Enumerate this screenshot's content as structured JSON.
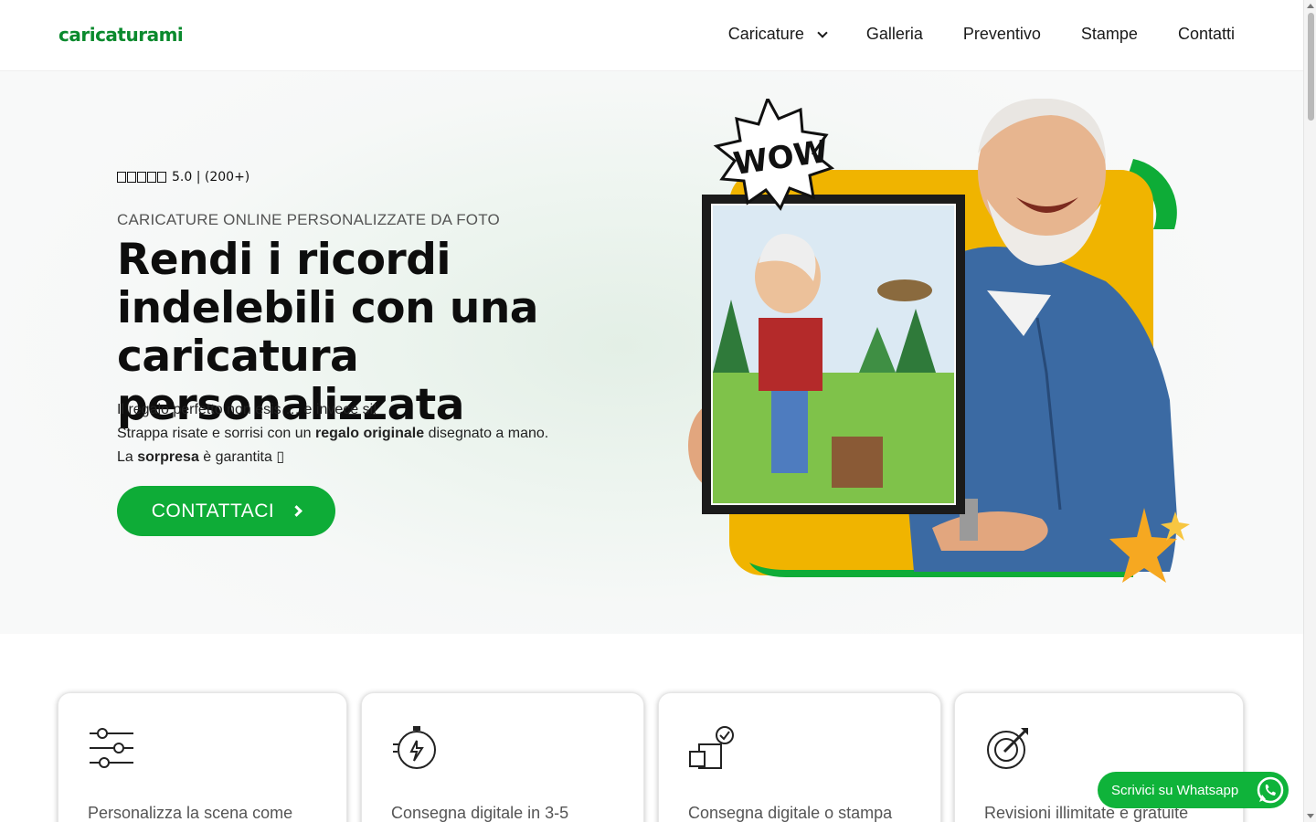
{
  "header": {
    "logo": "caricaturami",
    "nav": [
      {
        "label": "Caricature",
        "has_dropdown": true
      },
      {
        "label": "Galleria"
      },
      {
        "label": "Preventivo"
      },
      {
        "label": "Stampe"
      },
      {
        "label": "Contatti"
      }
    ]
  },
  "hero": {
    "rating": "5.0 | (200+)",
    "subtitle": "CARICATURE ONLINE PERSONALIZZATE DA FOTO",
    "title": "Rendi i ricordi indelebili con una caricatura personalizzata",
    "desc_line1": "Il regalo perfetto non esis … e invece si!",
    "desc_line2_pre": "Strappa risate e sorrisi con un ",
    "desc_line2_bold": "regalo originale",
    "desc_line2_post": " disegnato a mano.",
    "desc_line3_pre": "La ",
    "desc_line3_bold": "sorpresa",
    "desc_line3_post": " è garantita ▯",
    "cta_label": "CONTATTACI",
    "wow_text": "WOW"
  },
  "features": [
    {
      "icon": "sliders-icon",
      "text": "Personalizza la scena come"
    },
    {
      "icon": "stopwatch-icon",
      "text": "Consegna digitale in 3-5"
    },
    {
      "icon": "delivery-box-icon",
      "text": "Consegna digitale o stampa"
    },
    {
      "icon": "revision-pencil-icon",
      "text": "Revisioni illimitate e gratuite"
    }
  ],
  "whatsapp": {
    "label": "Scrivici su Whatsapp"
  },
  "colors": {
    "brand_green": "#0eac37",
    "logo_green": "#0a8a2e",
    "accent_yellow": "#f0b400"
  }
}
